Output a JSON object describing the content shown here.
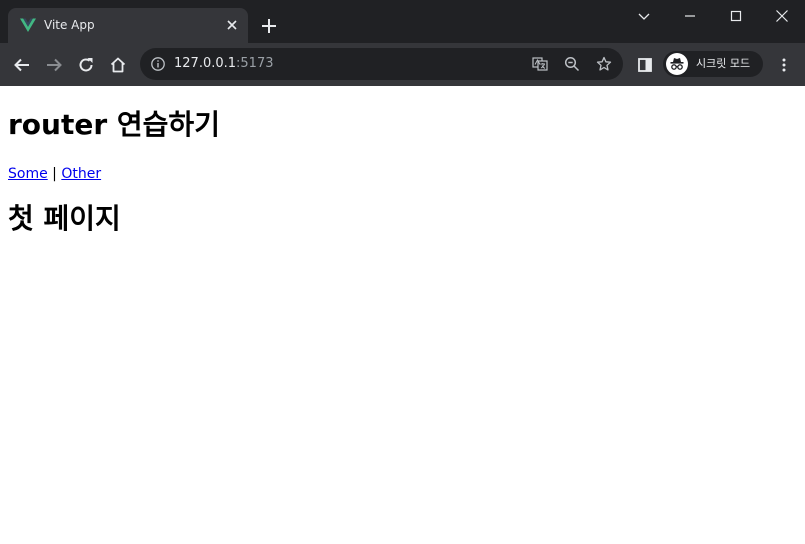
{
  "browser": {
    "tab": {
      "title": "Vite App",
      "favicon": "vue-logo-icon"
    },
    "address": {
      "host": "127.0.0.1",
      "port": ":5173"
    },
    "profile": {
      "label": "시크릿 모드",
      "icon": "incognito-icon"
    },
    "colors": {
      "frame": "#202124",
      "toolbar": "#35363a",
      "text": "#e8eaed",
      "vue_green": "#42b883",
      "vue_dark": "#35495e"
    }
  },
  "page": {
    "title": "router 연습하기",
    "nav": {
      "some_label": "Some",
      "separator": " | ",
      "other_label": "Other"
    },
    "view_title": "첫 페이지",
    "link_color": "#0000ee"
  }
}
